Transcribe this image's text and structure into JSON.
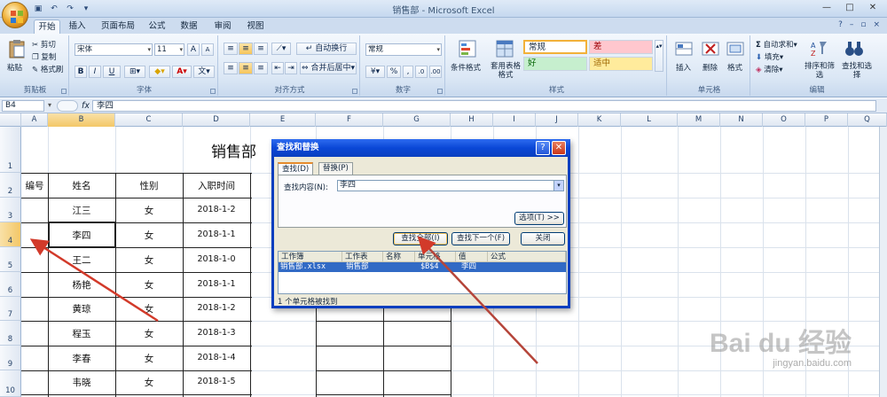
{
  "window": {
    "title": "销售部 - Microsoft Excel"
  },
  "ribbon": {
    "tabs": [
      "开始",
      "插入",
      "页面布局",
      "公式",
      "数据",
      "审阅",
      "视图"
    ],
    "clipboard": {
      "paste": "粘贴",
      "cut": "剪切",
      "copy": "复制",
      "format_painter": "格式刷",
      "label": "剪贴板"
    },
    "font": {
      "name": "宋体",
      "size": "11",
      "label": "字体",
      "bold": "B",
      "italic": "I",
      "underline": "U"
    },
    "alignment": {
      "wrap": "自动换行",
      "merge": "合并后居中",
      "label": "对齐方式"
    },
    "number": {
      "format": "常规",
      "label": "数字",
      "percent": "%",
      "comma": ","
    },
    "styles": {
      "conditional": "条件格式",
      "table": "套用表格格式",
      "normal": "常规",
      "bad": "差",
      "good": "好",
      "neutral": "适中",
      "label": "样式"
    },
    "cells": {
      "insert": "插入",
      "delete": "删除",
      "format": "格式",
      "label": "单元格"
    },
    "editing": {
      "autosum": "自动求和",
      "fill": "填充",
      "clear": "清除",
      "sort": "排序和筛选",
      "find": "查找和选择",
      "label": "编辑"
    }
  },
  "formula_bar": {
    "name_box": "B4",
    "fx": "fx",
    "content": "李四"
  },
  "columns": [
    "A",
    "B",
    "C",
    "D",
    "E",
    "F",
    "G",
    "H",
    "I",
    "J",
    "K",
    "L",
    "M",
    "N",
    "O",
    "P",
    "Q"
  ],
  "rows": [
    "1",
    "2",
    "3",
    "4",
    "5",
    "6",
    "7",
    "8",
    "9",
    "10"
  ],
  "sheet": {
    "title": "销售部",
    "headers": [
      "编号",
      "姓名",
      "性别",
      "入职时间"
    ],
    "data": [
      {
        "name": "江三",
        "gender": "女",
        "date": "2018-1-2"
      },
      {
        "name": "李四",
        "gender": "女",
        "date": "2018-1-1"
      },
      {
        "name": "王二",
        "gender": "女",
        "date": "2018-1-0"
      },
      {
        "name": "杨艳",
        "gender": "女",
        "date": "2018-1-1"
      },
      {
        "name": "黄琼",
        "gender": "女",
        "date": "2018-1-2"
      },
      {
        "name": "程玉",
        "gender": "女",
        "date": "2018-1-3"
      },
      {
        "name": "李春",
        "gender": "女",
        "date": "2018-1-4"
      },
      {
        "name": "韦晓",
        "gender": "女",
        "date": "2018-1-5"
      }
    ]
  },
  "dialog": {
    "title": "查找和替换",
    "tab_find": "查找(D)",
    "tab_replace": "替换(P)",
    "find_label": "查找内容(N):",
    "find_value": "李四",
    "options_btn": "选项(T) >>",
    "find_all_btn": "查找全部(I)",
    "find_next_btn": "查找下一个(F)",
    "close_btn": "关闭",
    "result_headers": [
      "工作簿",
      "工作表",
      "名称",
      "单元格",
      "值",
      "公式"
    ],
    "result_row": {
      "workbook": "销售部.xlsx",
      "sheet": "销售部",
      "name": "",
      "cell": "$B$4",
      "value": "李四",
      "formula": ""
    },
    "status": "1 个单元格被找到"
  },
  "watermark": {
    "brand": "Bai du 经验",
    "url": "jingyan.baidu.com"
  },
  "colors": {
    "accent": "#0a3fbf",
    "arrow": "#d23a2a",
    "selected_header": "#f3c767"
  }
}
